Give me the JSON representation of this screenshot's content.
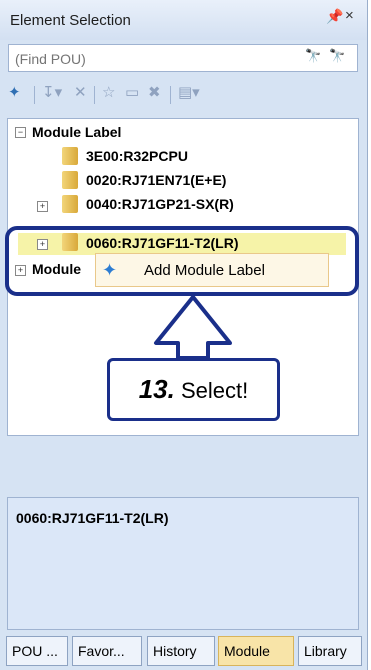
{
  "window": {
    "title": "Element Selection",
    "pin_glyph": "٢",
    "close_glyph": "×"
  },
  "find": {
    "placeholder": "(Find POU)"
  },
  "toolbar": {
    "icons": [
      "add-label-icon",
      "dropdown-icon",
      "remove-icon",
      "favorite-icon",
      "folder-icon",
      "delete-icon",
      "display-icon"
    ]
  },
  "tree": {
    "root_label": "Module Label",
    "items": [
      {
        "label": "3E00:R32PCPU"
      },
      {
        "label": "0020:RJ71EN71(E+E)"
      },
      {
        "label": "0040:RJ71GP21-SX(R)"
      },
      {
        "label": "0060:RJ71GF11-T2(LR)"
      }
    ],
    "second_root_label": "Module"
  },
  "context_menu": {
    "item_label": "Add Module Label"
  },
  "callout": {
    "step": "13.",
    "text": "Select!"
  },
  "info": {
    "selected_text": "0060:RJ71GF11-T2(LR)"
  },
  "tabs": [
    {
      "label": "POU ..."
    },
    {
      "label": "Favor..."
    },
    {
      "label": "History"
    },
    {
      "label": "Module"
    },
    {
      "label": "Library"
    }
  ],
  "colors": {
    "highlight": "#f6f3a8",
    "callout": "#1a2f8a",
    "active_tab": "#f8e4a8"
  }
}
